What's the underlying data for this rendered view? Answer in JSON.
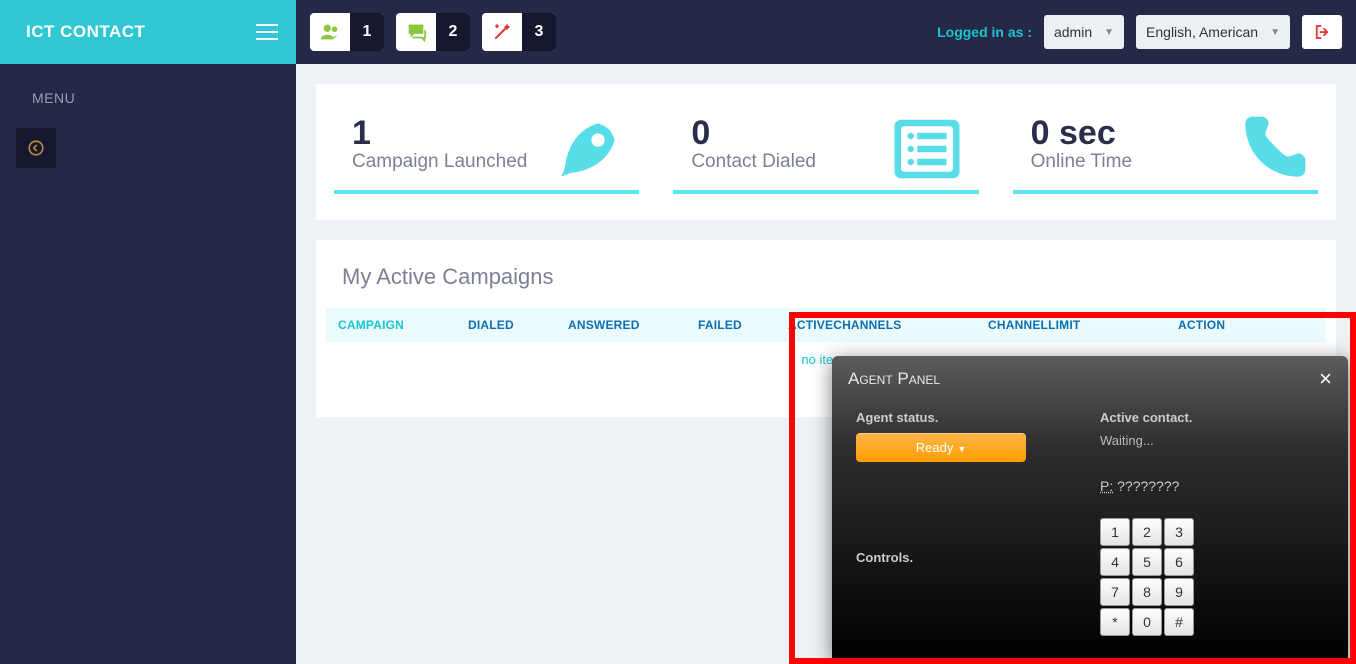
{
  "brand": "ICT CONTACT",
  "sidebar": {
    "menu_label": "MENU"
  },
  "topbar": {
    "steps": [
      "1",
      "2",
      "3"
    ],
    "logged_in_label": "Logged in as :",
    "user": "admin",
    "language": "English, American"
  },
  "stats": [
    {
      "value": "1",
      "label": "Campaign Launched"
    },
    {
      "value": "0",
      "label": "Contact Dialed"
    },
    {
      "value": "0 sec",
      "label": "Online Time"
    }
  ],
  "table": {
    "title": "My Active Campaigns",
    "columns": {
      "campaign": "CAMPAIGN",
      "dialed": "DIALED",
      "answered": "ANSWERED",
      "failed": "FAILED",
      "active": "ACTIVECHANNELS",
      "limit": "CHANNELLIMIT",
      "action": "ACTION"
    },
    "empty": "no items"
  },
  "agent_panel": {
    "title": "Agent Panel",
    "status_label": "Agent status.",
    "status_button": "Ready",
    "controls_label": "Controls.",
    "contact_label": "Active contact.",
    "waiting": "Waiting...",
    "phone_prefix": "P:",
    "phone_value": "????????",
    "keys": [
      "1",
      "2",
      "3",
      "4",
      "5",
      "6",
      "7",
      "8",
      "9",
      "*",
      "0",
      "#"
    ]
  }
}
